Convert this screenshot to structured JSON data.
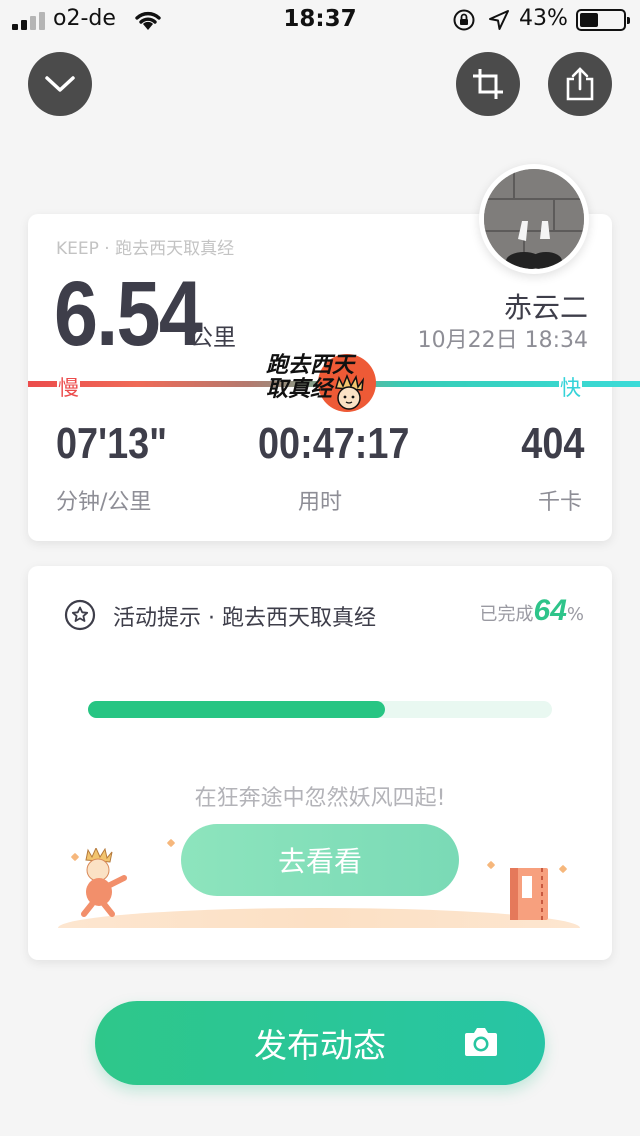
{
  "status_bar": {
    "carrier": "o2-de",
    "time": "18:37",
    "battery_percent": "43%",
    "battery_level": 0.43,
    "signal_bars_filled": 2,
    "signal_bars_total": 4,
    "icons": [
      "signal-icon",
      "wifi-icon",
      "orientation-lock-icon",
      "location-arrow-icon",
      "battery-icon"
    ]
  },
  "toolbar": {
    "icons": [
      "chevron-down-icon",
      "crop-icon",
      "share-icon"
    ]
  },
  "run": {
    "source": "KEEP · 跑去西天取真经",
    "distance": "6.54",
    "distance_unit": "公里",
    "user_name": "赤云二",
    "date": "10月22日 18:34",
    "speed_slow_label": "慢",
    "speed_fast_label": "快",
    "badge_line1": "跑去西天",
    "badge_line2": "取真经",
    "stats": {
      "pace_value": "07'13\"",
      "pace_label": "分钟/公里",
      "duration_value": "00:47:17",
      "duration_label": "用时",
      "calories_value": "404",
      "calories_label": "千卡"
    }
  },
  "activity": {
    "title": "活动提示 · 跑去西天取真经",
    "completed_prefix": "已完成",
    "completed_value": "64",
    "completed_suffix": "%",
    "progress": 0.64,
    "message": "在狂奔途中忽然妖风四起!",
    "cta_label": "去看看"
  },
  "footer": {
    "publish_label": "发布动态"
  },
  "colors": {
    "accent_green": "#27c583",
    "slow_red": "#ec4c4c",
    "fast_cyan": "#34d3d9"
  }
}
